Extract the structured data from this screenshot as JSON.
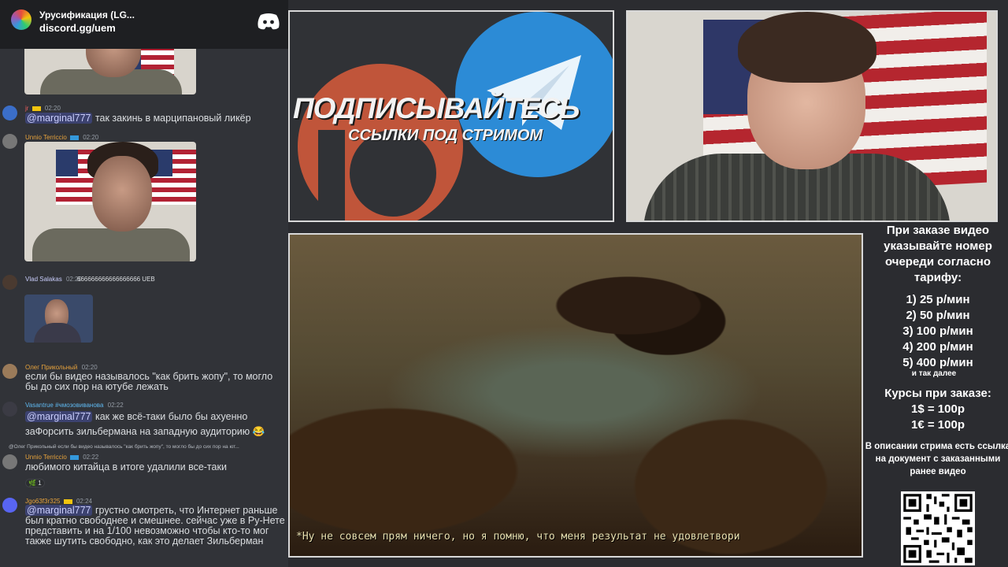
{
  "discord": {
    "server_name": "Урусификация (LG...",
    "invite": "discord.gg/uem"
  },
  "chat": {
    "messages": [
      {
        "user": "jr",
        "time": "02:20",
        "text_mention": "@marginal777",
        "text": " так закинь в марципановый ликёр"
      },
      {
        "user": "Unnio Terriccio",
        "time": "02:20",
        "text": ""
      },
      {
        "user": "Vlad Salakas",
        "time": "02:20",
        "text": "666666666666666666 UEB"
      },
      {
        "user": "Олег Прикольный",
        "time": "02:20",
        "text": "если бы видео называлось \"как брить жопу\", то могло бы до сих пор на ютубе лежать"
      },
      {
        "user": "Vasantrue #чмозовиванова",
        "time": "02:22",
        "text_mention": "@marginal777",
        "text": " как же всё-таки было бы ахуенно заФорсить зильбермана на западную аудиторию 😂"
      },
      {
        "reply": "@Олег Прикольный если бы видео называлось \"как брить жопу\", то могло бы до сих пор на ют...",
        "user": "Unnio Terriccio",
        "time": "02:22",
        "text": "любимого китайца в итоге удалили все-таки",
        "reaction": "1"
      },
      {
        "user": "Jgo63f3r325",
        "time": "02:24",
        "text_mention": "@marginal777",
        "text": " грустно смотреть, что Интернет раньше был кратно свободнее и смешнее. сейчас уже в Ру-Нете представить и на 1/100 невозможно чтобы кто-то мог также шутить свободно, как это делает Зильберман"
      }
    ]
  },
  "promo": {
    "title": "ПОДПИСЫВАЙТЕСЬ",
    "subtitle": "ССЫЛКИ ПОД СТРИМОМ"
  },
  "video": {
    "subtitle": "*Ну не совсем прям ничего, но я помню, что меня результат не удовлетвори"
  },
  "info": {
    "order_note": "При заказе видео указывайте номер очереди согласно тарифу:",
    "tariffs": [
      "1) 25 р/мин",
      "2) 50 р/мин",
      "3) 100 р/мин",
      "4) 200 р/мин",
      "5) 400 р/мин"
    ],
    "etc": "и так далее",
    "courses_title": "Курсы при заказе:",
    "courses": [
      "1$ = 100р",
      "1€ = 100р"
    ],
    "desc_note": "В описании стрима есть ссылка на документ с заказанными ранее видео"
  },
  "colors": {
    "discord_blurple": "#5865f2",
    "patreon": "#c0553a",
    "telegram": "#2c8bd6",
    "mention_bg": "#3c4270"
  }
}
